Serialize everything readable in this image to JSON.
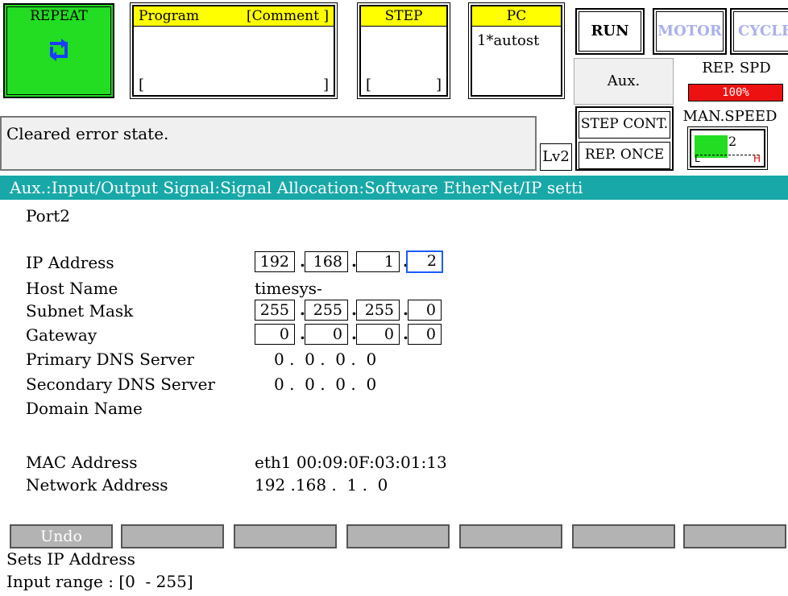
{
  "header": {
    "repeat": {
      "label": "REPEAT",
      "icon": "cycle-arrows-icon"
    },
    "program": {
      "title_left": "Program",
      "title_right": "[Comment ]",
      "bracket_left": "[",
      "bracket_right": "]"
    },
    "step": {
      "title": "STEP",
      "bracket_left": "[",
      "bracket_right": "]"
    },
    "pc": {
      "title": "PC",
      "value": "1*autost"
    },
    "run": "RUN",
    "motor": "MOTOR",
    "cycle": "CYCLE",
    "aux": "Aux.",
    "rep_spd": {
      "label": "REP. SPD",
      "value": "100%"
    },
    "step_cont": "STEP CONT.",
    "rep_once": "REP. ONCE",
    "lv2": "Lv2",
    "man_speed": {
      "label": "MAN.SPEED",
      "level": "2",
      "low": "L",
      "high": "H",
      "level_fraction": 0.5
    }
  },
  "message": "Cleared error state.",
  "breadcrumb": "Aux.:Input/Output Signal:Signal Allocation:Software EtherNet/IP setti",
  "port": "Port2",
  "fields": {
    "ip": {
      "label": "IP Address",
      "octets": [
        "192",
        "168",
        "1",
        "2"
      ]
    },
    "host": {
      "label": "Host Name",
      "value": "timesys-"
    },
    "subnet": {
      "label": "Subnet Mask",
      "octets": [
        "255",
        "255",
        "255",
        "0"
      ]
    },
    "gateway": {
      "label": "Gateway",
      "octets": [
        "0",
        "0",
        "0",
        "0"
      ]
    },
    "dns1": {
      "label": "Primary DNS Server",
      "value": "0 .  0 .  0 .  0"
    },
    "dns2": {
      "label": "Secondary DNS Server",
      "value": "0 .  0 .  0 .  0"
    },
    "domain": {
      "label": "Domain Name",
      "value": ""
    },
    "mac": {
      "label": "MAC Address",
      "value": "eth1 00:09:0F:03:01:13"
    },
    "network": {
      "label": "Network Address",
      "value": "192 .168 .  1 .  0"
    }
  },
  "fkeys": [
    "Undo",
    "",
    "",
    "",
    "",
    "",
    ""
  ],
  "help": {
    "line1": "Sets IP Address",
    "line2": "Input range : [0  - 255]"
  },
  "colors": {
    "repeat_bg": "#22dd22",
    "header_yellow": "#ffff00",
    "breadcrumb_bg": "#18a8a8",
    "rep_spd_red": "#ee1111",
    "active_field": "#1a5aff"
  }
}
